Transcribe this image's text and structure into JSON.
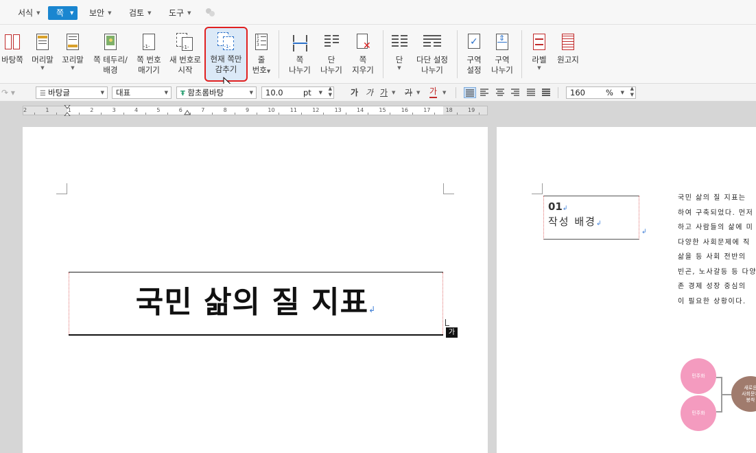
{
  "menubar": {
    "items": [
      {
        "label": "서식"
      },
      {
        "label": "쪽",
        "active": true
      },
      {
        "label": "보안"
      },
      {
        "label": "검토"
      },
      {
        "label": "도구"
      }
    ]
  },
  "ribbon": {
    "buttons": [
      {
        "id": "bg-page",
        "label": "바탕쪽"
      },
      {
        "id": "header",
        "label": "머리말"
      },
      {
        "id": "footer",
        "label": "꼬리말"
      },
      {
        "id": "border-bg",
        "label1": "쪽 테두리/",
        "label2": "배경"
      },
      {
        "id": "page-num",
        "label1": "쪽 번호",
        "label2": "매기기"
      },
      {
        "id": "new-num",
        "label1": "새 번호로",
        "label2": "시작"
      },
      {
        "id": "hide-page",
        "label1": "현재 쪽만",
        "label2": "감추기"
      },
      {
        "id": "line-num",
        "label1": "줄",
        "label2": "번호"
      },
      {
        "id": "page-break",
        "label1": "쪽",
        "label2": "나누기"
      },
      {
        "id": "col-break",
        "label1": "단",
        "label2": "나누기"
      },
      {
        "id": "page-delete",
        "label1": "쪽",
        "label2": "지우기"
      },
      {
        "id": "columns",
        "label": "단"
      },
      {
        "id": "multi-col",
        "label1": "다단 설정",
        "label2": "나누기"
      },
      {
        "id": "section-set",
        "label1": "구역",
        "label2": "설정"
      },
      {
        "id": "section-break",
        "label1": "구역",
        "label2": "나누기"
      },
      {
        "id": "label",
        "label": "라벨"
      },
      {
        "id": "manuscript",
        "label": "원고지"
      }
    ]
  },
  "format": {
    "style": "바탕글",
    "lang": "대표",
    "font": "함초롬바탕",
    "size": "10.0",
    "unit": "pt",
    "bold": "가",
    "italic": "가",
    "underline": "가",
    "strike": "가",
    "color": "가",
    "zoom": "160",
    "zoom_unit": "%"
  },
  "ruler": {
    "numbers": [
      "2",
      "1",
      "1",
      "2",
      "3",
      "4",
      "5",
      "6",
      "7",
      "8",
      "9",
      "10",
      "11",
      "12",
      "13",
      "14",
      "15",
      "16",
      "17",
      "18",
      "19"
    ]
  },
  "document": {
    "title": "국민 삶의 질 지표",
    "cursor_badge": "가",
    "section_number": "01",
    "section_title": "작성 배경",
    "body_lines": [
      "국민 삶의 질 지표는",
      "하여 구축되었다. 먼저",
      "하고 사람들의 삶에 미",
      "다양한 사회문제에 직",
      "삶을 등 사회 전반의 ",
      "빈곤, 노사갈등 등 다양",
      "존 경제 성장 중심의 ",
      "이 필요한 상황이다."
    ],
    "diagram": {
      "circle1": "민주화",
      "circle2": "민주화",
      "circle3_l1": "새로운",
      "circle3_l2": "사회문제",
      "circle3_l3": "봉착"
    }
  },
  "colors": {
    "accent": "#1a86d0",
    "highlight_border": "#e02020",
    "pink": "#f49bbf",
    "brown": "#a07b6d"
  }
}
